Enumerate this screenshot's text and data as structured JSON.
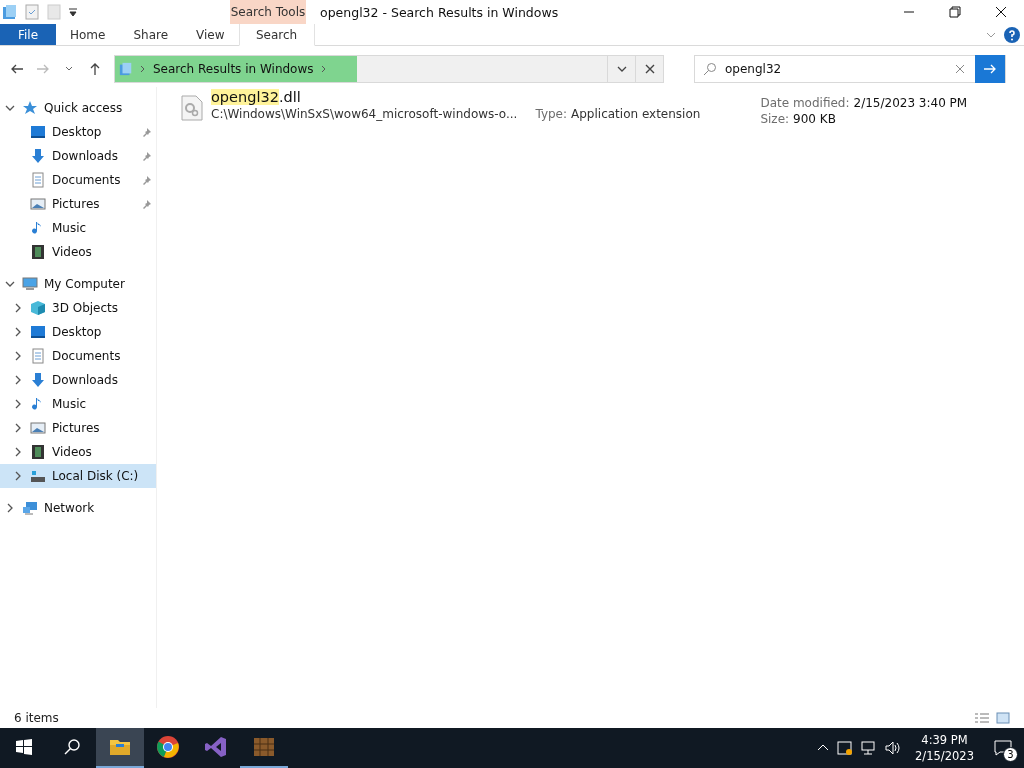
{
  "window": {
    "title": "opengl32 - Search Results in Windows"
  },
  "ribbon": {
    "context_label": "Search Tools",
    "tabs": [
      {
        "label": "File",
        "kind": "file",
        "selected": false
      },
      {
        "label": "Home",
        "kind": "plain",
        "selected": false
      },
      {
        "label": "Share",
        "kind": "plain",
        "selected": false
      },
      {
        "label": "View",
        "kind": "plain",
        "selected": false
      },
      {
        "label": "Search",
        "kind": "context",
        "selected": true
      }
    ]
  },
  "address_bar": {
    "crumb": "Search Results in Windows"
  },
  "search": {
    "value": "opengl32"
  },
  "navigation": [
    {
      "label": "Quick access",
      "kind": "star",
      "expanded": true,
      "selected": false,
      "children": [
        {
          "label": "Desktop",
          "kind": "desktop",
          "pinned": true
        },
        {
          "label": "Downloads",
          "kind": "downloads",
          "pinned": true
        },
        {
          "label": "Documents",
          "kind": "documents",
          "pinned": true
        },
        {
          "label": "Pictures",
          "kind": "pictures",
          "pinned": true
        },
        {
          "label": "Music",
          "kind": "music",
          "pinned": false
        },
        {
          "label": "Videos",
          "kind": "videos",
          "pinned": false
        }
      ]
    },
    {
      "label": "My Computer",
      "kind": "computer",
      "expanded": true,
      "selected": false,
      "children": [
        {
          "label": "3D Objects",
          "kind": "objects",
          "expanded": false,
          "selected": false
        },
        {
          "label": "Desktop",
          "kind": "desktop",
          "expanded": false,
          "selected": false
        },
        {
          "label": "Documents",
          "kind": "documents",
          "expanded": false,
          "selected": false
        },
        {
          "label": "Downloads",
          "kind": "downloads",
          "expanded": false,
          "selected": false
        },
        {
          "label": "Music",
          "kind": "music",
          "expanded": false,
          "selected": false
        },
        {
          "label": "Pictures",
          "kind": "pictures",
          "expanded": false,
          "selected": false
        },
        {
          "label": "Videos",
          "kind": "videos",
          "expanded": false,
          "selected": false
        },
        {
          "label": "Local Disk (C:)",
          "kind": "disk",
          "expanded": false,
          "selected": true
        }
      ]
    },
    {
      "label": "Network",
      "kind": "network",
      "expanded": false,
      "selected": false
    }
  ],
  "results": [
    {
      "name_parts": [
        {
          "text": "opengl32",
          "highlighted": true
        },
        {
          "text": ".dll",
          "highlighted": false
        }
      ],
      "path": "C:\\Windows\\WinSxS\\wow64_microsoft-windows-o...",
      "type_label": "Type:",
      "type": "Application extension",
      "date_label": "Date modified:",
      "date": "2/15/2023 3:40 PM",
      "size_label": "Size:",
      "size": "900 KB"
    }
  ],
  "status_bar": {
    "count": "6 items"
  },
  "taskbar": {
    "apps": [
      {
        "kind": "explorer",
        "active": true
      },
      {
        "kind": "chrome",
        "active": false
      },
      {
        "kind": "studio",
        "active": false
      },
      {
        "kind": "crate",
        "active": false
      }
    ],
    "time": "4:39 PM",
    "date": "2/15/2023",
    "notifications": "3"
  }
}
